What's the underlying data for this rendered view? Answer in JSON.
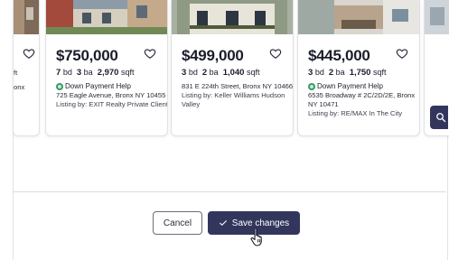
{
  "cards": [
    {
      "price": "$750,000",
      "beds": "7",
      "baths": "3",
      "sqft": "2,970",
      "bd_unit": "bd",
      "ba_unit": "ba",
      "sqft_unit": "sqft",
      "badge": "Down Payment Help",
      "address": "725 Eagle Avenue, Bronx NY 10455",
      "listing": "Listing by: EXIT Realty Private Client"
    },
    {
      "price": "$499,000",
      "beds": "3",
      "baths": "2",
      "sqft": "1,040",
      "bd_unit": "bd",
      "ba_unit": "ba",
      "sqft_unit": "sqft",
      "badge": "",
      "address": "831 E 224th Street, Bronx NY 10466",
      "listing": "Listing by: Keller Williams Hudson Valley"
    },
    {
      "price": "$445,000",
      "beds": "3",
      "baths": "2",
      "sqft": "1,750",
      "bd_unit": "bd",
      "ba_unit": "ba",
      "sqft_unit": "sqft",
      "badge": "Down Payment Help",
      "address": "6535 Broadway # 2C/2D/2E, Bronx NY 10471",
      "listing": "Listing by: RE/MAX In The City"
    }
  ],
  "partial_card": {
    "line1": "ft",
    "line2": "onx"
  },
  "actions": {
    "cancel_label": "Cancel",
    "save_label": "Save changes"
  },
  "icons": {
    "heart": "heart-icon",
    "check": "check-icon",
    "search": "search-icon",
    "cursor": "hand-pointer-icon",
    "badge": "down-payment-icon"
  },
  "colors": {
    "primary": "#33365c",
    "badge_green": "#3a9a6b"
  }
}
